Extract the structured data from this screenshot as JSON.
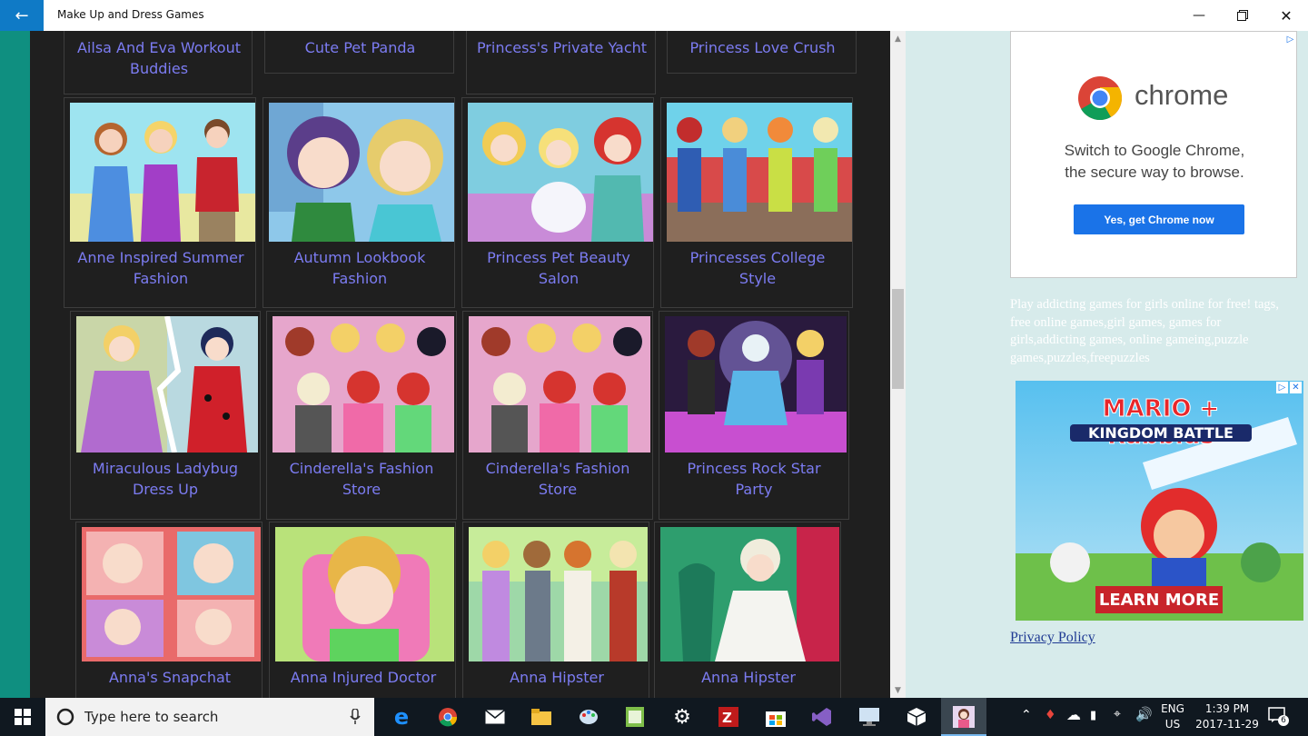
{
  "window": {
    "title": "Make Up and Dress Games",
    "back_icon": "back-arrow-icon",
    "minimize_icon": "minimize-icon",
    "restore_icon": "restore-icon",
    "close_icon": "close-icon"
  },
  "games_top_row": [
    {
      "title": "Ailsa And Eva Workout Buddies"
    },
    {
      "title": "Cute Pet Panda"
    },
    {
      "title": "Princess's Private Yacht"
    },
    {
      "title": "Princess Love Crush"
    }
  ],
  "games": [
    {
      "title": "Anne Inspired Summer Fashion"
    },
    {
      "title": "Autumn Lookbook Fashion"
    },
    {
      "title": "Princess Pet Beauty Salon"
    },
    {
      "title": "Princesses College Style"
    },
    {
      "title": "Miraculous Ladybug Dress Up"
    },
    {
      "title": "Cinderella's Fashion Store"
    },
    {
      "title": "Cinderella's Fashion Store"
    },
    {
      "title": "Princess Rock Star Party"
    },
    {
      "title": "Anna's Snapchat"
    },
    {
      "title": "Anna Injured Doctor"
    },
    {
      "title": "Anna Hipster"
    },
    {
      "title": "Anna Hipster"
    }
  ],
  "sidebar": {
    "chrome_ad": {
      "word": "chrome",
      "line1": "Switch to Google Chrome,",
      "line2": "the secure way to browse.",
      "button": "Yes, get Chrome now"
    },
    "description": "Play addicting games for girls online for free! tags, free online games,girl games, games for girls,addicting games, online gameing,puzzle games,puzzles,freepuzzles",
    "mario_ad": {
      "title_line1": "MARIO + Rabbids",
      "title_line2": "KINGDOM BATTLE",
      "button": "LEARN MORE"
    },
    "privacy_link": "Privacy Policy"
  },
  "taskbar": {
    "search_placeholder": "Type here to search",
    "language_line1": "ENG",
    "language_line2": "US",
    "time": "1:39 PM",
    "date": "2017-11-29",
    "notification_count": "6"
  },
  "colors": {
    "accent": "#0f7ac6",
    "game_title": "#7c7cf2",
    "grid_bg": "#1f1f1f",
    "side_bg": "#d7ebeb",
    "left_strip": "#0f8f80"
  }
}
